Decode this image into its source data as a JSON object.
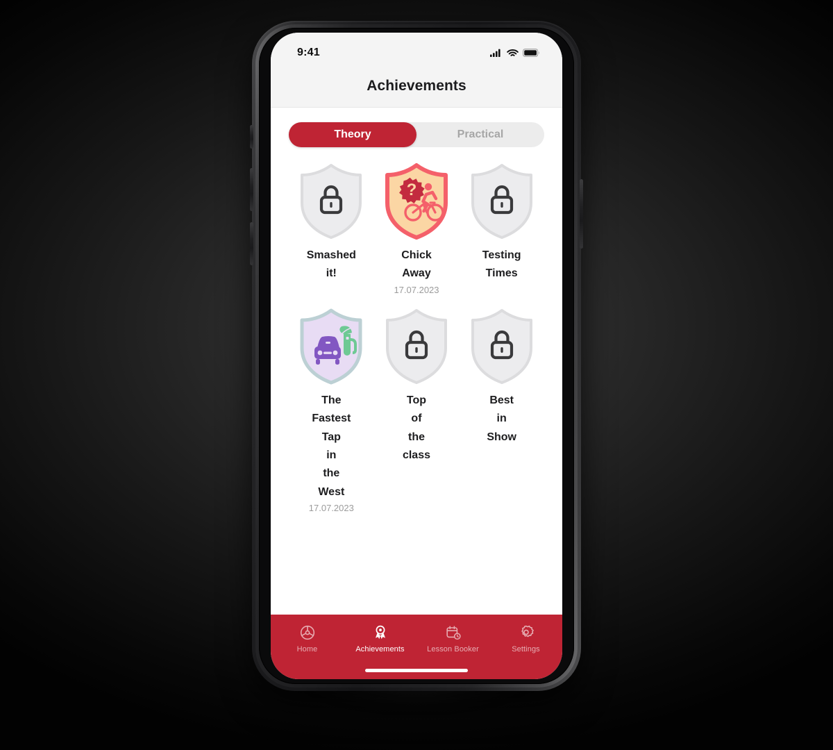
{
  "device": {
    "buttons": [
      "silent-switch",
      "volume-up",
      "volume-down",
      "power"
    ]
  },
  "status_bar": {
    "time": "9:41",
    "icons": [
      "cellular-signal-icon",
      "wifi-icon",
      "battery-icon"
    ]
  },
  "header": {
    "title": "Achievements"
  },
  "segmented_control": {
    "options": [
      {
        "label": "Theory",
        "active": true
      },
      {
        "label": "Practical",
        "active": false
      }
    ]
  },
  "achievements": [
    {
      "title": "Smashed it!",
      "date": "",
      "locked": true,
      "icon": "lock-icon",
      "shield_fill": "#ececee",
      "shield_stroke": "#dcdcde"
    },
    {
      "title": "Chick Away",
      "date": "17.07.2023",
      "locked": false,
      "icon": "cyclist-quiz-icon",
      "shield_fill": "#fbd6a4",
      "shield_stroke": "#f4606a"
    },
    {
      "title": "Testing Times",
      "date": "",
      "locked": true,
      "icon": "lock-icon",
      "shield_fill": "#ececee",
      "shield_stroke": "#dcdcde"
    },
    {
      "title": "The Fastest Tap in the West",
      "date": "17.07.2023",
      "locked": false,
      "icon": "eco-car-charging-icon",
      "shield_fill": "#e8dcf4",
      "shield_stroke": "#bcd0d4"
    },
    {
      "title": "Top of the class",
      "date": "",
      "locked": true,
      "icon": "lock-icon",
      "shield_fill": "#ececee",
      "shield_stroke": "#dcdcde"
    },
    {
      "title": "Best in Show",
      "date": "",
      "locked": true,
      "icon": "lock-icon",
      "shield_fill": "#ececee",
      "shield_stroke": "#dcdcde"
    }
  ],
  "tab_bar": {
    "background": "#bf2434",
    "items": [
      {
        "label": "Home",
        "icon": "steering-wheel-icon",
        "active": false
      },
      {
        "label": "Achievements",
        "icon": "award-ribbon-icon",
        "active": true
      },
      {
        "label": "Lesson Booker",
        "icon": "calendar-clock-icon",
        "active": false
      },
      {
        "label": "Settings",
        "icon": "gear-icon",
        "active": false
      }
    ]
  },
  "colors": {
    "brand_red": "#bf2434",
    "accent_coral": "#f4606a",
    "text_primary": "#1d1d1f",
    "text_muted": "#9b9b9b",
    "segment_track": "#ececec",
    "screen_bg": "#ffffff",
    "statusbar_bg": "#f4f4f4"
  }
}
